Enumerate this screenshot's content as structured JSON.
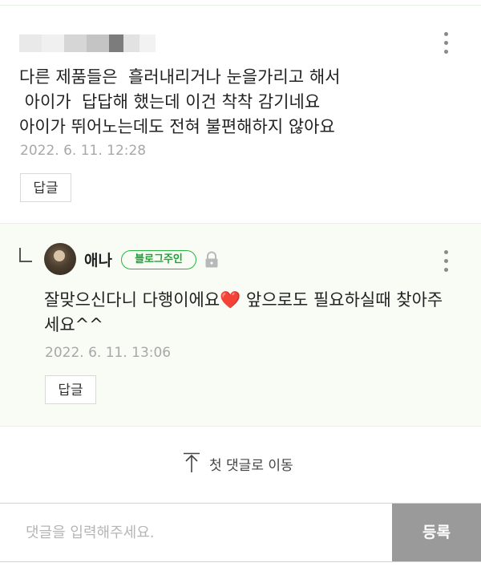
{
  "comment": {
    "author_obscured": true,
    "lines": [
      "다른 제품들은  흘러내리거나 눈을가리고 해서",
      " 아이가  답답해 했는데 이건 착착 감기네요",
      "아이가 뛰어노는데도 전혀 불편해하지 않아요"
    ],
    "date": "2022. 6. 11. 12:28",
    "reply_label": "답글"
  },
  "reply": {
    "author": "애나",
    "badge": "블로그주인",
    "lines": [
      "잘맞으신다니 다행이에요❤️ 앞으로도 필요하실때 찾아주",
      "세요^^"
    ],
    "date": "2022. 6. 11. 13:06",
    "reply_label": "답글"
  },
  "goto_first": {
    "label": "첫 댓글로 이동"
  },
  "input": {
    "placeholder": "댓글을 입력해주세요.",
    "submit_label": "등록"
  },
  "colors": {
    "badge_green": "#27b53f",
    "submit_bg": "#9a9a9a",
    "reply_bg": "#f8fcf5"
  },
  "icons": [
    "more-vertical-icon",
    "reply-arrow-icon",
    "lock-icon",
    "up-arrow-icon"
  ]
}
